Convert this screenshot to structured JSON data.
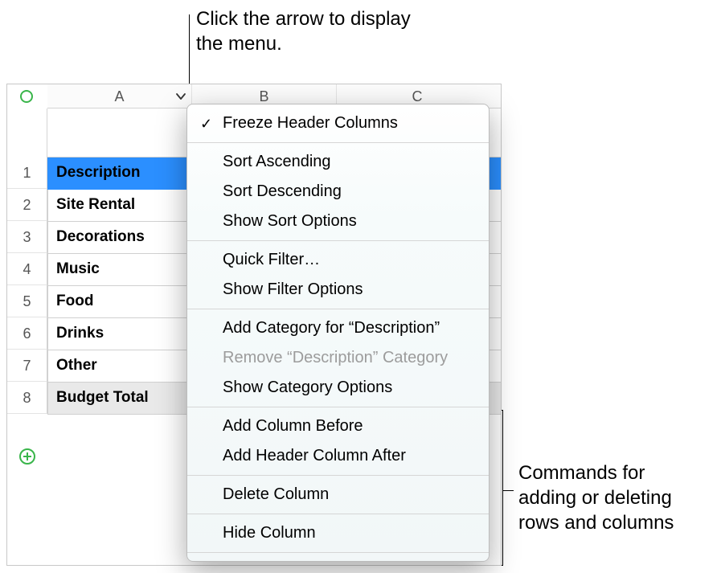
{
  "callouts": {
    "top": "Click the arrow to display the menu.",
    "right_line1": "Commands for",
    "right_line2": "adding or deleting",
    "right_line3": "rows and columns"
  },
  "columns": [
    "A",
    "B",
    "C"
  ],
  "rows": [
    "1",
    "2",
    "3",
    "4",
    "5",
    "6",
    "7",
    "8"
  ],
  "cells": {
    "a1": "Description",
    "a2": "Site Rental",
    "a3": "Decorations",
    "a4": "Music",
    "a5": "Food",
    "a6": "Drinks",
    "a7": "Other",
    "a8": "Budget Total"
  },
  "menu": {
    "freeze": "Freeze Header Columns",
    "sort_asc": "Sort Ascending",
    "sort_desc": "Sort Descending",
    "sort_opts": "Show Sort Options",
    "quick_filter": "Quick Filter…",
    "filter_opts": "Show Filter Options",
    "add_cat": "Add Category for “Description”",
    "remove_cat": "Remove “Description” Category",
    "cat_opts": "Show Category Options",
    "add_before": "Add Column Before",
    "add_after": "Add Header Column After",
    "delete": "Delete Column",
    "hide": "Hide Column"
  }
}
